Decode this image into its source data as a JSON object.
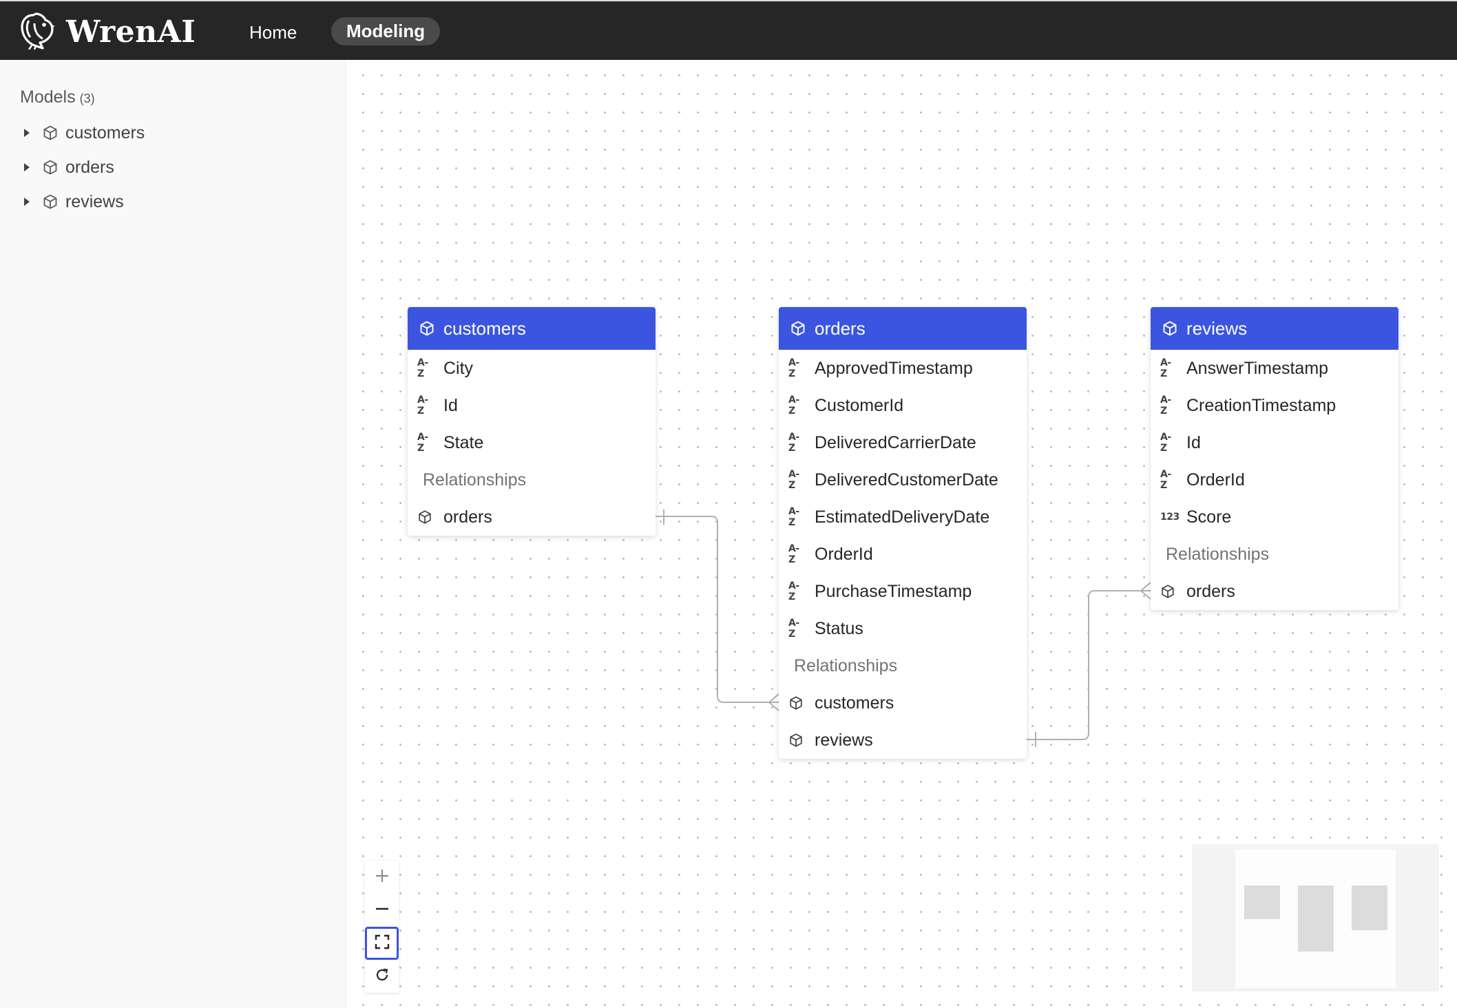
{
  "app": {
    "brand": "WrenAI"
  },
  "nav": {
    "home": "Home",
    "modeling": "Modeling"
  },
  "sidebar": {
    "title": "Models",
    "count": "(3)",
    "items": [
      {
        "label": "customers",
        "icon": "cube-icon"
      },
      {
        "label": "orders",
        "icon": "cube-icon"
      },
      {
        "label": "reviews",
        "icon": "cube-icon"
      }
    ]
  },
  "diagram": {
    "relationships_label": "Relationships",
    "models": [
      {
        "name": "customers",
        "fields": [
          {
            "type": "A-Z",
            "name": "City"
          },
          {
            "type": "A-Z",
            "name": "Id"
          },
          {
            "type": "A-Z",
            "name": "State"
          }
        ],
        "relationships": [
          "orders"
        ]
      },
      {
        "name": "orders",
        "fields": [
          {
            "type": "A-Z",
            "name": "ApprovedTimestamp"
          },
          {
            "type": "A-Z",
            "name": "CustomerId"
          },
          {
            "type": "A-Z",
            "name": "DeliveredCarrierDate"
          },
          {
            "type": "A-Z",
            "name": "DeliveredCustomerDate"
          },
          {
            "type": "A-Z",
            "name": "EstimatedDeliveryDate"
          },
          {
            "type": "A-Z",
            "name": "OrderId"
          },
          {
            "type": "A-Z",
            "name": "PurchaseTimestamp"
          },
          {
            "type": "A-Z",
            "name": "Status"
          }
        ],
        "relationships": [
          "customers",
          "reviews"
        ]
      },
      {
        "name": "reviews",
        "fields": [
          {
            "type": "A-Z",
            "name": "AnswerTimestamp"
          },
          {
            "type": "A-Z",
            "name": "CreationTimestamp"
          },
          {
            "type": "A-Z",
            "name": "Id"
          },
          {
            "type": "A-Z",
            "name": "OrderId"
          },
          {
            "type": "123",
            "name": "Score"
          }
        ],
        "relationships": [
          "orders"
        ]
      }
    ]
  },
  "controls": [
    "zoom-in-icon",
    "zoom-out-icon",
    "fit-view-icon",
    "refresh-icon"
  ],
  "colors": {
    "topbar": "#262626",
    "header_accent": "#3b55e0",
    "canvas_dot": "#b9b9b9",
    "edge": "#b0b0b0"
  }
}
